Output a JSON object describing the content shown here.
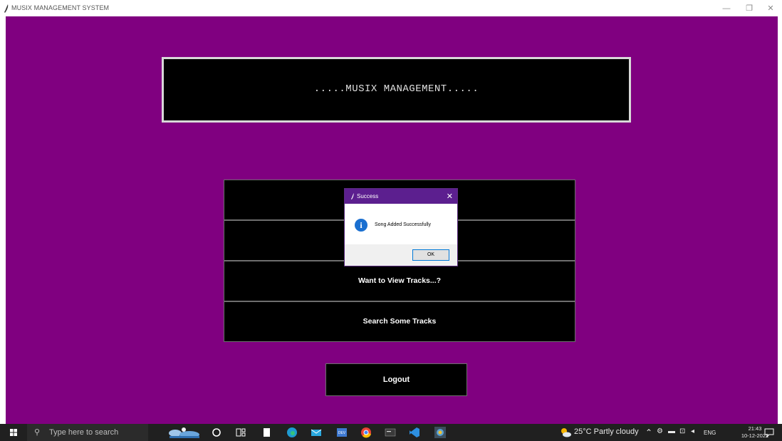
{
  "window": {
    "title": "MUSIX MANAGEMENT SYSTEM",
    "minimize_glyph": "—",
    "maximize_glyph": "❐",
    "close_glyph": "✕"
  },
  "banner": {
    "text": ".....MUSIX MANAGEMENT....."
  },
  "menu": {
    "view_tracks": "Want to View Tracks...?",
    "search_tracks": "Search Some Tracks",
    "logout": "Logout"
  },
  "dialog": {
    "title": "Success",
    "close_glyph": "✕",
    "info_glyph": "i",
    "message": "Song Added Successfully",
    "ok_label": "OK"
  },
  "taskbar": {
    "search_placeholder": "Type here to search",
    "weather": "25°C  Partly cloudy",
    "language": "ENG",
    "time": "21:43",
    "date": "10-12-2022"
  },
  "colors": {
    "app_background": "#800080",
    "dialog_titlebar": "#5c1f8f",
    "info_icon": "#1a6fd0"
  }
}
